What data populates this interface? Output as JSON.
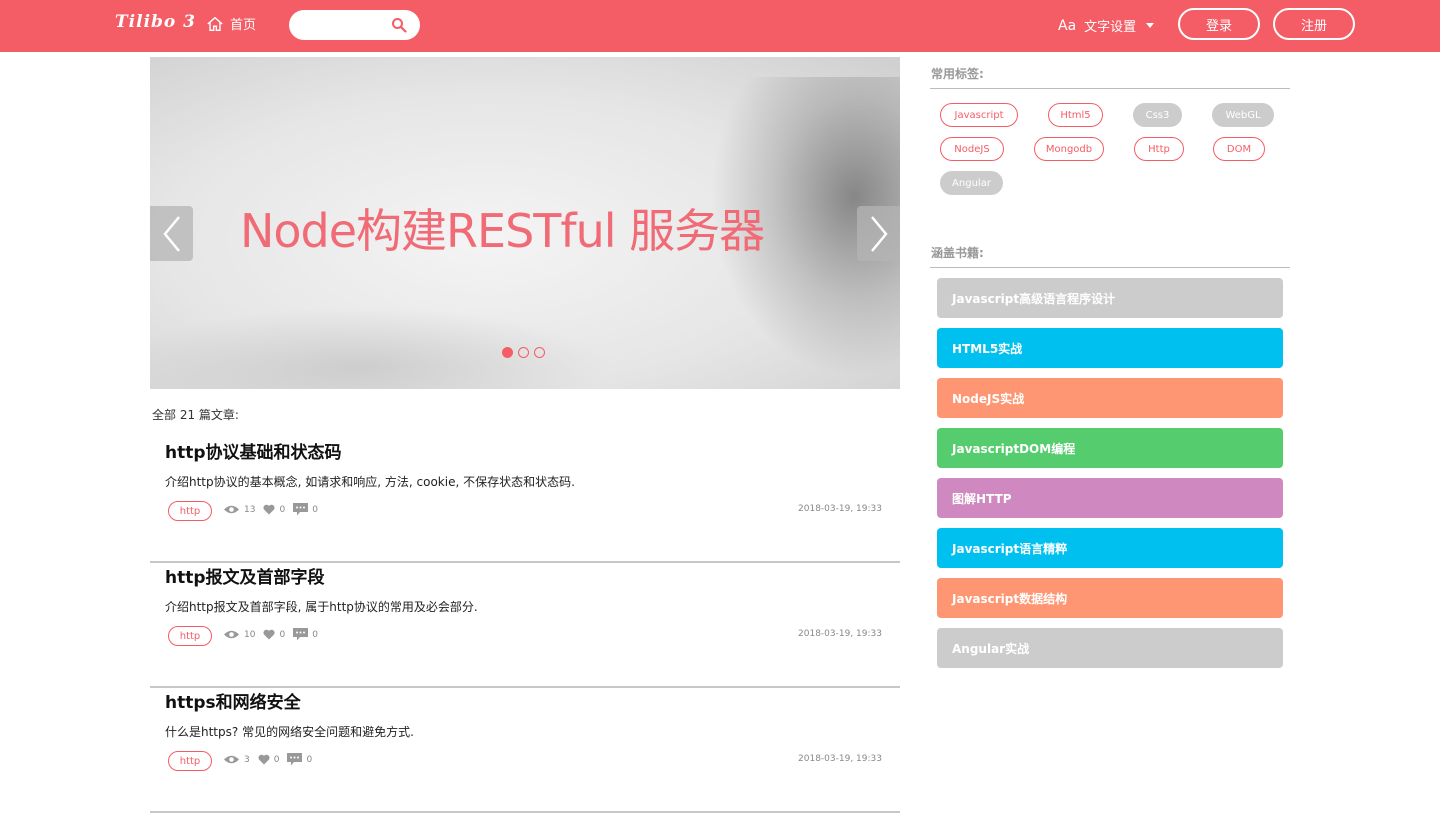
{
  "header": {
    "logo": "Tilibo 3",
    "home_label": "首页",
    "search_placeholder": "",
    "font_setting_icon_text": "Aa",
    "font_setting_label": "文字设置",
    "login_label": "登录",
    "register_label": "注册"
  },
  "carousel": {
    "slide_title": "Node构建RESTful 服务器",
    "dot_count": 3,
    "active_dot": 0
  },
  "article_count": "全部 21 篇文章:",
  "articles": [
    {
      "title": "http协议基础和状态码",
      "desc": "介绍http协议的基本概念, 如请求和响应, 方法, cookie, 不保存状态和状态码.",
      "tag": "http",
      "views": "13",
      "likes": "0",
      "comments": "0",
      "date": "2018-03-19, 19:33"
    },
    {
      "title": "http报文及首部字段",
      "desc": "介绍http报文及首部字段, 属于http协议的常用及必会部分.",
      "tag": "http",
      "views": "10",
      "likes": "0",
      "comments": "0",
      "date": "2018-03-19, 19:33"
    },
    {
      "title": "https和网络安全",
      "desc": "什么是https? 常见的网络安全问题和避免方式.",
      "tag": "http",
      "views": "3",
      "likes": "0",
      "comments": "0",
      "date": "2018-03-19, 19:33"
    }
  ],
  "sidebar": {
    "tags_heading": "常用标签:",
    "tags": [
      {
        "label": "Javascript",
        "style": "outline"
      },
      {
        "label": "Html5",
        "style": "outline"
      },
      {
        "label": "Css3",
        "style": "filled"
      },
      {
        "label": "WebGL",
        "style": "filled"
      },
      {
        "label": "NodeJS",
        "style": "outline"
      },
      {
        "label": "Mongodb",
        "style": "outline"
      },
      {
        "label": "Http",
        "style": "outline"
      },
      {
        "label": "DOM",
        "style": "outline"
      },
      {
        "label": "Angular",
        "style": "filled"
      }
    ],
    "books_heading": "涵盖书籍:",
    "books": [
      {
        "label": "Javascript高级语言程序设计",
        "color": "#cccccc"
      },
      {
        "label": "HTML5实战",
        "color": "#00c0f0"
      },
      {
        "label": "NodeJS实战",
        "color": "#ff9673"
      },
      {
        "label": "JavascriptDOM编程",
        "color": "#55cc6e"
      },
      {
        "label": "图解HTTP",
        "color": "#cf89c0"
      },
      {
        "label": "Javascript语言精粹",
        "color": "#00c0f0"
      },
      {
        "label": "Javascript数据结构",
        "color": "#ff9673"
      },
      {
        "label": "Angular实战",
        "color": "#cccccc"
      }
    ]
  },
  "colors": {
    "accent": "#f55d66"
  }
}
